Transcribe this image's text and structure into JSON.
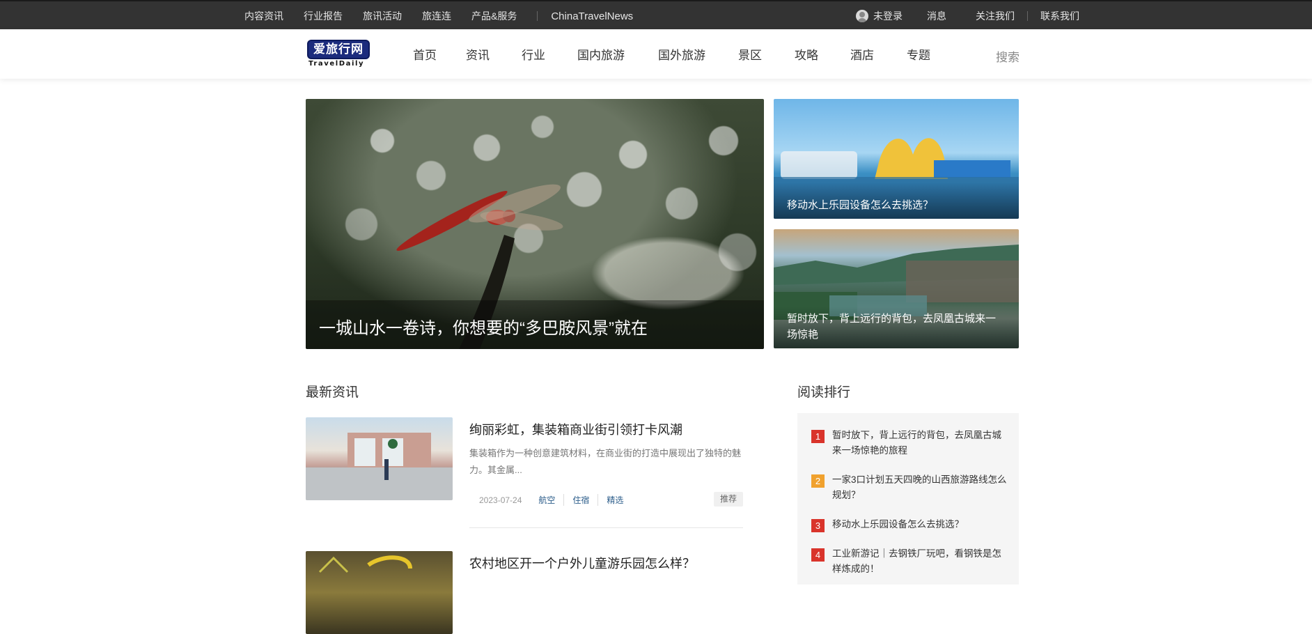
{
  "topbar": {
    "left_links": [
      "内容资讯",
      "行业报告",
      "旅讯活动",
      "旅连连",
      "产品&服务"
    ],
    "brand_link": "ChinaTravelNews",
    "login": "未登录",
    "messages": "消息",
    "follow": "关注我们",
    "contact": "联系我们"
  },
  "logo": {
    "cn": "爱旅行网",
    "en": "TravelDaily"
  },
  "nav": {
    "items": [
      "首页",
      "资讯",
      "行业",
      "国内旅游",
      "国外旅游",
      "景区",
      "攻略",
      "酒店",
      "专题"
    ],
    "search": "搜索"
  },
  "hero": {
    "main_caption": "一城山水一卷诗，你想要的“多巴胺风景”就在",
    "side": [
      {
        "caption": "移动水上乐园设备怎么去挑选？"
      },
      {
        "caption": "暂时放下，背上远行的背包，去凤凰古城来一场惊艳"
      }
    ]
  },
  "latest": {
    "title": "最新资讯",
    "items": [
      {
        "title": "绚丽彩虹，集装箱商业街引领打卡风潮",
        "summary": "集装箱作为一种创意建筑材料，在商业街的打造中展现出了独特的魅力。其金属...",
        "date": "2023-07-24",
        "tags": [
          "航空",
          "住宿",
          "精选"
        ],
        "badge": "推荐"
      },
      {
        "title": "农村地区开一个户外儿童游乐园怎么样？"
      }
    ]
  },
  "ranking": {
    "title": "阅读排行",
    "items": [
      {
        "num": "1",
        "text": "暂时放下，背上远行的背包，去凤凰古城来一场惊艳的旅程",
        "color": "#d9342b"
      },
      {
        "num": "2",
        "text": "一家3口计划五天四晚的山西旅游路线怎么规划？",
        "color": "#f0a12e"
      },
      {
        "num": "3",
        "text": "移动水上乐园设备怎么去挑选？",
        "color": "#d9342b"
      },
      {
        "num": "4",
        "text": "工业新游记｜去钢铁厂玩吧，看钢铁是怎样炼成的！",
        "color": "#d9342b"
      }
    ]
  }
}
